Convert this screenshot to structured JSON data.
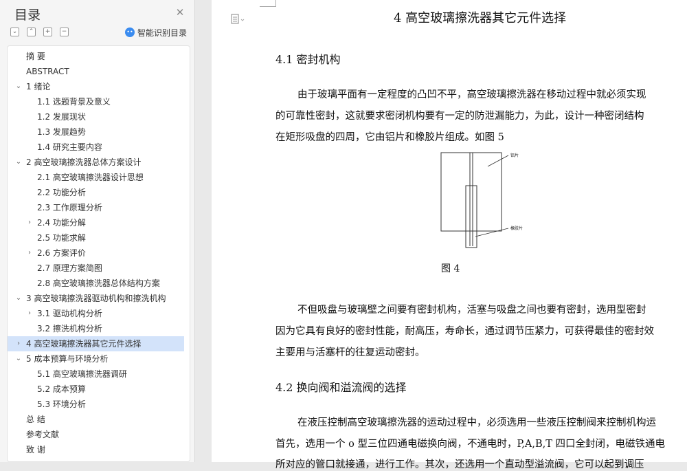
{
  "sidebar": {
    "title": "目录",
    "ai_label": "智能识别目录",
    "ai_icon": "ai-robot-icon",
    "items": [
      {
        "label": "摘    要",
        "level": 0,
        "chevron": "none"
      },
      {
        "label": "ABSTRACT",
        "level": 0,
        "chevron": "none"
      },
      {
        "label": "1  绪论",
        "level": 0,
        "chevron": "down"
      },
      {
        "label": "1.1 选题背景及意义",
        "level": 1,
        "chevron": "none"
      },
      {
        "label": "1.2 发展现状",
        "level": 1,
        "chevron": "none"
      },
      {
        "label": "1.3 发展趋势",
        "level": 1,
        "chevron": "none"
      },
      {
        "label": "1.4 研究主要内容",
        "level": 1,
        "chevron": "none"
      },
      {
        "label": "2  高空玻璃擦洗器总体方案设计",
        "level": 0,
        "chevron": "down"
      },
      {
        "label": "2.1  高空玻璃擦洗器设计思想",
        "level": 1,
        "chevron": "none"
      },
      {
        "label": "2.2 功能分析",
        "level": 1,
        "chevron": "none"
      },
      {
        "label": "2.3 工作原理分析",
        "level": 1,
        "chevron": "none"
      },
      {
        "label": "2.4 功能分解",
        "level": 1,
        "chevron": "right"
      },
      {
        "label": "2.5 功能求解",
        "level": 1,
        "chevron": "none"
      },
      {
        "label": "2.6 方案评价",
        "level": 1,
        "chevron": "right"
      },
      {
        "label": "2.7 原理方案简图",
        "level": 1,
        "chevron": "none"
      },
      {
        "label": "2.8  高空玻璃擦洗器总体结构方案",
        "level": 1,
        "chevron": "none"
      },
      {
        "label": "3  高空玻璃擦洗器驱动机构和擦洗机构",
        "level": 0,
        "chevron": "down"
      },
      {
        "label": "3.1  驱动机构分析",
        "level": 1,
        "chevron": "right"
      },
      {
        "label": "3.2 擦洗机构分析",
        "level": 1,
        "chevron": "none"
      },
      {
        "label": "4  高空玻璃擦洗器其它元件选择",
        "level": 0,
        "chevron": "right",
        "active": true
      },
      {
        "label": "5  成本预算与环境分析",
        "level": 0,
        "chevron": "down"
      },
      {
        "label": "5.1  高空玻璃擦洗器调研",
        "level": 1,
        "chevron": "none"
      },
      {
        "label": "5.2  成本预算",
        "level": 1,
        "chevron": "none"
      },
      {
        "label": "5.3  环境分析",
        "level": 1,
        "chevron": "none"
      },
      {
        "label": "总    结",
        "level": 0,
        "chevron": "none"
      },
      {
        "label": "参考文献",
        "level": 0,
        "chevron": "none"
      },
      {
        "label": "致    谢",
        "level": 0,
        "chevron": "none"
      }
    ]
  },
  "document": {
    "chapter_title": "4  高空玻璃擦洗器其它元件选择",
    "section1_title": "4.1 密封机构",
    "para1_lines": [
      "由于玻璃平面有一定程度的凸凹不平，高空玻璃擦洗器在移动过程中就必须实现",
      "的可靠性密封，这就要求密闭机构要有一定的防泄漏能力，为此，设计一种密闭结构",
      "在矩形吸盘的四周，它由铝片和橡胶片组成。如图 5"
    ],
    "figure_label_top": "铝片",
    "figure_label_bottom": "橡胶片",
    "figure_caption": "图 4",
    "para2_lines": [
      "不但吸盘与玻璃壁之间要有密封机构，活塞与吸盘之间也要有密封，选用型密封",
      "因为它具有良好的密封性能，耐高压，寿命长，通过调节压紧力，可获得最佳的密封效",
      "主要用与活塞杆的往复运动密封。"
    ],
    "section2_title": "4.2 换向阀和溢流阀的选择",
    "para3_lines": [
      "在液压控制高空玻璃擦洗器的运动过程中，必须选用一些液压控制阀来控制机构运",
      "首先，选用一个 o 型三位四通电磁换向阀，不通电时，P,A,B,T 四口全封闭，电磁铁通电",
      "所对应的管口就接通，进行工作。其次，还选用一个直动型溢流阀，它可以起到调压"
    ]
  }
}
